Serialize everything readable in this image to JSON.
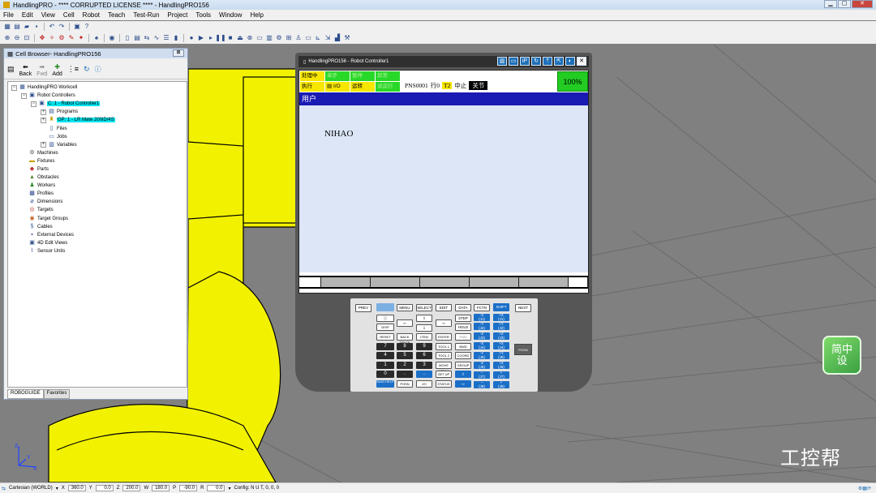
{
  "app": {
    "title": "HandlingPRO - **** CORRUPTED LICENSE **** - HandlingPRO156"
  },
  "menu": [
    "File",
    "Edit",
    "View",
    "Cell",
    "Robot",
    "Teach",
    "Test-Run",
    "Project",
    "Tools",
    "Window",
    "Help"
  ],
  "cell_browser": {
    "title": "Cell Browser- HandlingPRO156",
    "close_label": "⊠",
    "nav": {
      "back": "Back",
      "fwd": "Fwd",
      "add": "Add"
    },
    "tree": [
      {
        "label": "HandlingPRO Workcell",
        "indent": 0,
        "exp": "−",
        "icon": "workcell-icon"
      },
      {
        "label": "Robot Controllers",
        "indent": 1,
        "exp": "−",
        "icon": "controller-icon"
      },
      {
        "label": "C: 1 - Robot Controller1",
        "indent": 2,
        "exp": "−",
        "icon": "controller-icon",
        "selected": true
      },
      {
        "label": "Programs",
        "indent": 3,
        "exp": "+",
        "icon": "folder-icon"
      },
      {
        "label": "GP: 1 - LR Mate 200iD/4S",
        "indent": 3,
        "exp": "+",
        "icon": "robot-icon",
        "selected": true
      },
      {
        "label": "Files",
        "indent": 3,
        "exp": "",
        "icon": "file-icon"
      },
      {
        "label": "Jobs",
        "indent": 3,
        "exp": "",
        "icon": "jobs-icon"
      },
      {
        "label": "Variables",
        "indent": 3,
        "exp": "+",
        "icon": "variables-icon"
      },
      {
        "label": "Machines",
        "indent": 1,
        "exp": "",
        "icon": "machine-icon"
      },
      {
        "label": "Fixtures",
        "indent": 1,
        "exp": "",
        "icon": "fixture-icon"
      },
      {
        "label": "Parts",
        "indent": 1,
        "exp": "",
        "icon": "part-icon"
      },
      {
        "label": "Obstacles",
        "indent": 1,
        "exp": "",
        "icon": "obstacle-icon"
      },
      {
        "label": "Workers",
        "indent": 1,
        "exp": "",
        "icon": "worker-icon"
      },
      {
        "label": "Profiles",
        "indent": 1,
        "exp": "",
        "icon": "profile-icon"
      },
      {
        "label": "Dimensions",
        "indent": 1,
        "exp": "",
        "icon": "dimension-icon"
      },
      {
        "label": "Targets",
        "indent": 1,
        "exp": "",
        "icon": "target-icon"
      },
      {
        "label": "Target Groups",
        "indent": 1,
        "exp": "",
        "icon": "target-group-icon"
      },
      {
        "label": "Cables",
        "indent": 1,
        "exp": "",
        "icon": "cable-icon"
      },
      {
        "label": "External Devices",
        "indent": 1,
        "exp": "",
        "icon": "device-icon"
      },
      {
        "label": "4D Edit Views",
        "indent": 1,
        "exp": "",
        "icon": "view-icon"
      },
      {
        "label": "Sensor Units",
        "indent": 1,
        "exp": "",
        "icon": "sensor-icon"
      }
    ],
    "tabs": [
      "ROBOGUIDE",
      "Favorites"
    ]
  },
  "pendant": {
    "title": "HandlingPRO156 - Robot Controller1",
    "icons": [
      "▥",
      "▭",
      "iP",
      "↻",
      "⇡",
      "⇱",
      "◐",
      "✕"
    ],
    "lamps": {
      "busy": "处理中",
      "step": "单步",
      "hold": "暂停",
      "fault": "异常",
      "run": "执行",
      "io": "I/O",
      "prod": "运转",
      "test": "试运行"
    },
    "prog": "PNS0001",
    "line": "行0",
    "t2": "T2",
    "stopped": "中止",
    "joint": "关节",
    "override": "100%",
    "screen_title": "用户",
    "message": "NIHAO"
  },
  "keypad": {
    "prev": "PREV",
    "menu": "MENU",
    "select": "SELECT",
    "edit": "EDIT",
    "data": "DATA",
    "fctn": "FCTN",
    "shift": "SHIFT",
    "next": "NEXT",
    "step": "STEP",
    "hold": "HOLD",
    "disp": "DISP",
    "reset": "RESET",
    "backspace": "BACK SPACE",
    "item": "ITEM",
    "enter": "ENTER",
    "tool1": "TOOL 1",
    "tool2": "TOOL 2",
    "move_menu": "MOVE MENU",
    "setup": "SET UP",
    "diag": "DIAG HELP",
    "posn": "POSN",
    "io": "I/O",
    "status": "STATUS",
    "coord": "COORD",
    "group": "GROUP",
    "fwd": "FWD",
    "bwd": "BWD",
    "digits": [
      "7",
      "8",
      "9",
      "4",
      "5",
      "6",
      "1",
      "2",
      "3",
      "0",
      "."
    ],
    "posn_side": "POSN",
    "off_on": "OFF ON"
  },
  "bottombar": {
    "coord_mode": "Cartesian (WORLD)",
    "x_label": "X",
    "x": "360.0",
    "y_label": "Y",
    "y": "0.0",
    "z_label": "Z",
    "z": "200.0",
    "w_label": "W",
    "w": "180.0",
    "p_label": "P",
    "p": "-90.0",
    "r_label": "R",
    "r": "0.0",
    "config": "Config: N U T, 0, 0, 0"
  },
  "overlay": {
    "logo_text": "简中设",
    "watermark": "工控帮"
  },
  "colors": {
    "robot_yellow": "#f2f200",
    "pendant": "#565656",
    "screen_blue": "#1a1ab4",
    "selection": "#00e5f0"
  }
}
